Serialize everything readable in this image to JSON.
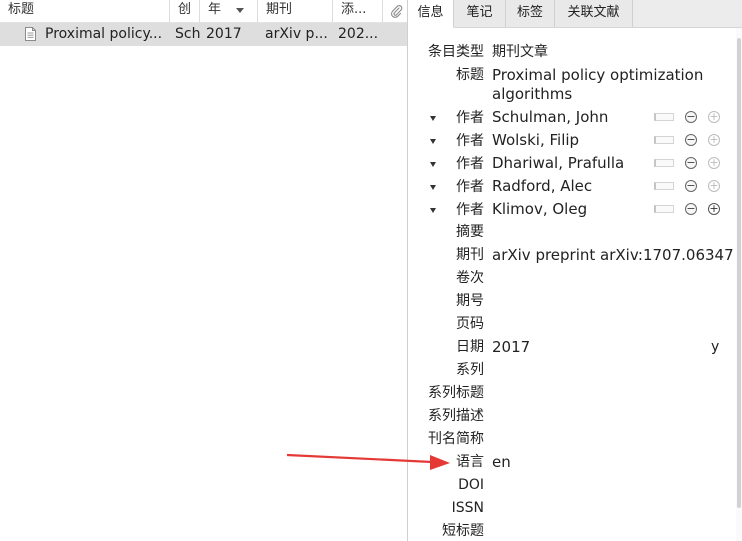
{
  "list": {
    "columns": {
      "title": "标题",
      "creator": "创",
      "year": "年",
      "publication": "期刊",
      "date_added": "添..."
    },
    "rows": [
      {
        "title": "Proximal policy...",
        "creator": "Sch",
        "year": "2017",
        "publication": "arXiv p...",
        "date_added": "202..."
      }
    ]
  },
  "tabs": [
    "信息",
    "笔记",
    "标签",
    "关联文献"
  ],
  "info": {
    "item_type_label": "条目类型",
    "item_type_value": "期刊文章",
    "title_label": "标题",
    "title_value": "Proximal policy optimization algorithms",
    "creators": [
      {
        "role": "作者",
        "name": "Schulman, John"
      },
      {
        "role": "作者",
        "name": "Wolski, Filip"
      },
      {
        "role": "作者",
        "name": "Dhariwal, Prafulla"
      },
      {
        "role": "作者",
        "name": "Radford, Alec"
      },
      {
        "role": "作者",
        "name": "Klimov, Oleg"
      }
    ],
    "abstract_label": "摘要",
    "publication_label": "期刊",
    "publication_value": "arXiv preprint arXiv:1707.06347",
    "volume_label": "卷次",
    "issue_label": "期号",
    "pages_label": "页码",
    "date_label": "日期",
    "date_value": "2017",
    "date_format": "y",
    "series_label": "系列",
    "series_title_label": "系列标题",
    "series_text_label": "系列描述",
    "journal_abbr_label": "刊名简称",
    "language_label": "语言",
    "language_value": "en",
    "doi_label": "DOI",
    "issn_label": "ISSN",
    "short_title_label": "短标题"
  },
  "colors": {
    "selected_row": "#dedede",
    "annotation_arrow": "#e53935"
  }
}
